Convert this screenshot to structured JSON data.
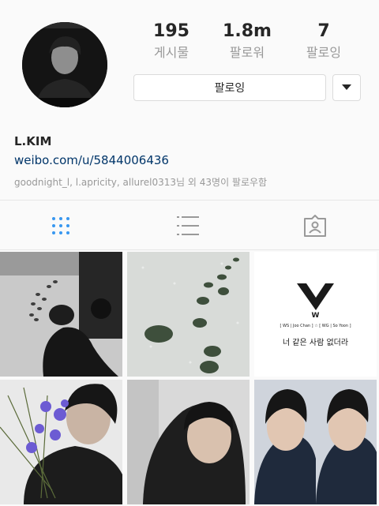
{
  "profile": {
    "username": "L.KIM",
    "link": "weibo.com/u/5844006436",
    "followed_by": "goodnight_l, l.apricity, allurel0313님 외 43명이 팔로우함"
  },
  "stats": [
    {
      "value": "195",
      "label": "게시물"
    },
    {
      "value": "1.8m",
      "label": "팔로워"
    },
    {
      "value": "7",
      "label": "팔로잉"
    }
  ],
  "actions": {
    "follow_label": "팔로잉",
    "dropdown_icon": "caret-down-icon"
  },
  "tabs": [
    {
      "icon": "grid-icon",
      "active": true
    },
    {
      "icon": "list-icon",
      "active": false
    },
    {
      "icon": "tagged-icon",
      "active": false
    }
  ],
  "posts": [
    {
      "kind": "photo"
    },
    {
      "kind": "photo"
    },
    {
      "kind": "graphic",
      "logo_letter": "W",
      "caption_line": "[ WS | Joo Chan ] ☆ [ WG | So Yoon ]",
      "title": "너 같은 사람 없더라"
    },
    {
      "kind": "photo"
    },
    {
      "kind": "photo"
    },
    {
      "kind": "photo"
    }
  ],
  "colors": {
    "accent_blue": "#3897f0",
    "link_blue": "#003569",
    "muted": "#999999",
    "border": "#dbdbdb"
  }
}
